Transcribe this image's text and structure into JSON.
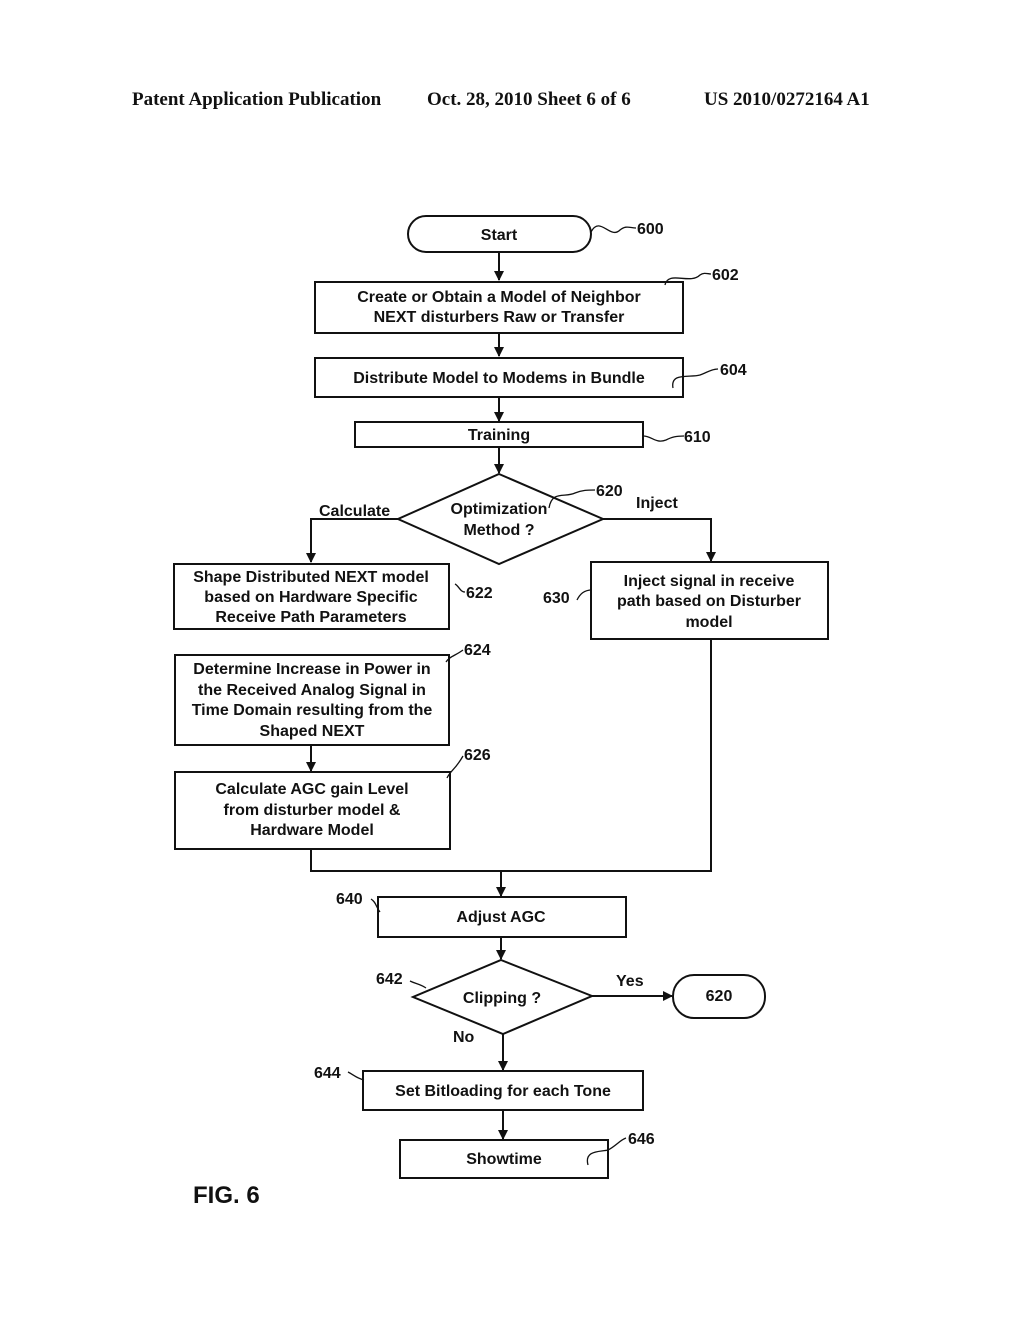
{
  "header": {
    "publication": "Patent Application Publication",
    "date_sheet": "Oct. 28, 2010   Sheet 6 of 6",
    "number": "US 2010/0272164 A1"
  },
  "figure_label": "FIG. 6",
  "nodes": {
    "start": {
      "ref": "600",
      "lines": [
        "Start"
      ]
    },
    "n602": {
      "ref": "602",
      "lines": [
        "Create or Obtain a Model of Neighbor",
        "NEXT disturbers Raw or Transfer"
      ]
    },
    "n604": {
      "ref": "604",
      "lines": [
        "Distribute Model to Modems in Bundle"
      ]
    },
    "n610": {
      "ref": "610",
      "lines": [
        "Training"
      ]
    },
    "n620": {
      "ref": "620",
      "lines": [
        "Optimization",
        "Method ?"
      ]
    },
    "n622": {
      "ref": "622",
      "lines": [
        "Shape Distributed NEXT model",
        "based on Hardware Specific",
        "Receive Path Parameters"
      ]
    },
    "n624": {
      "ref": "624",
      "lines": [
        "Determine Increase in Power in",
        "the Received Analog Signal in",
        "Time Domain resulting from the",
        "Shaped NEXT"
      ]
    },
    "n626": {
      "ref": "626",
      "lines": [
        "Calculate AGC gain Level",
        "from disturber model &",
        "Hardware Model"
      ]
    },
    "n630": {
      "ref": "630",
      "lines": [
        "Inject signal in receive",
        "path based on Disturber",
        "model"
      ]
    },
    "n640": {
      "ref": "640",
      "lines": [
        "Adjust AGC"
      ]
    },
    "n642": {
      "ref": "642",
      "lines": [
        "Clipping ?"
      ]
    },
    "n644": {
      "ref": "644",
      "lines": [
        "Set Bitloading for each Tone"
      ]
    },
    "n646": {
      "ref": "646",
      "lines": [
        "Showtime"
      ]
    },
    "goto620": {
      "lines": [
        "620"
      ]
    }
  },
  "edge_labels": {
    "calculate": "Calculate",
    "inject": "Inject",
    "yes": "Yes",
    "no": "No"
  }
}
